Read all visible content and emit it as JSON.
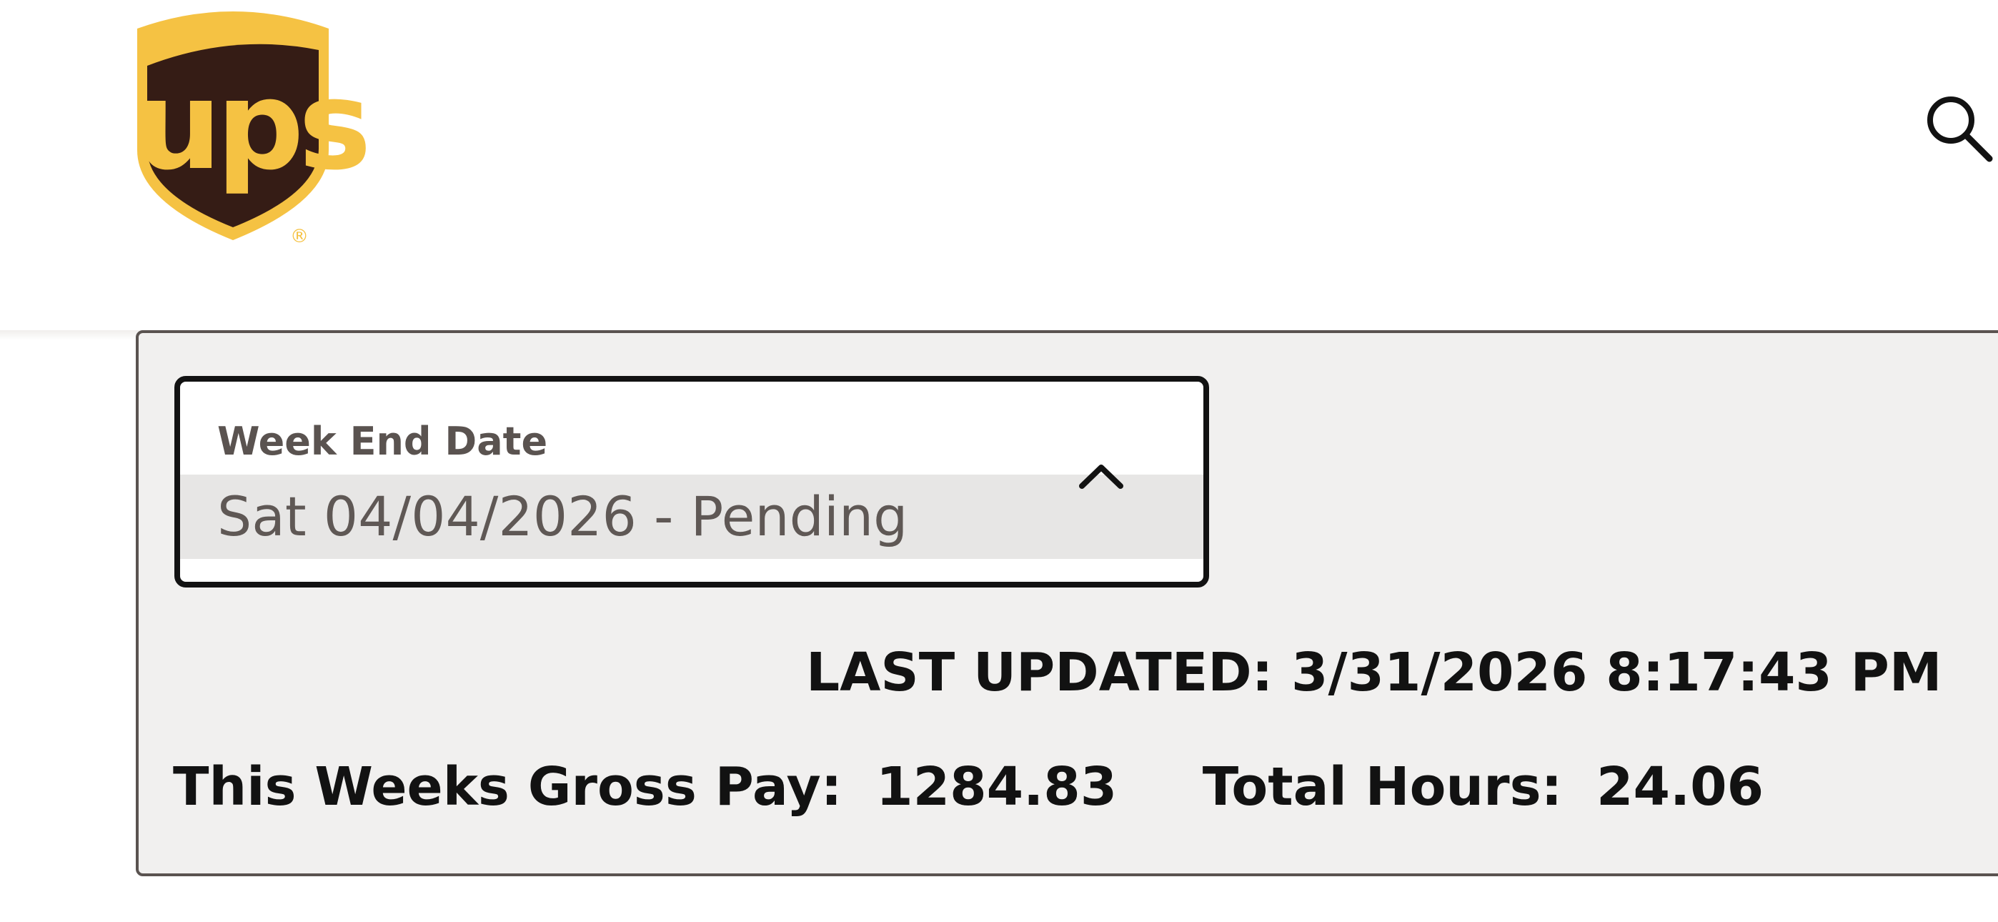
{
  "header": {
    "logo_text": "ups",
    "logo_registered_mark": "®",
    "search_icon": "search-icon",
    "colors": {
      "logo_gold": "#f5c243",
      "logo_brown": "#351c15"
    }
  },
  "week_selector": {
    "label": "Week End Date",
    "selected_value": "Sat 04/04/2026 - Pending",
    "chevron_icon": "chevron-up-icon"
  },
  "status": {
    "last_updated": "LAST UPDATED: 3/31/2026 8:17:43 PM"
  },
  "summary": {
    "gross_pay_label": "This Weeks Gross Pay:",
    "gross_pay_value": "1284.83",
    "total_hours_label": "Total Hours:",
    "total_hours_value": "24.06"
  }
}
